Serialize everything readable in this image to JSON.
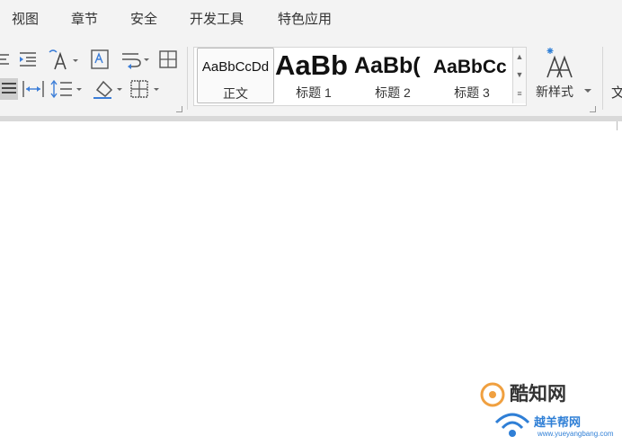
{
  "menu": {
    "items": [
      "视图",
      "章节",
      "安全",
      "开发工具",
      "特色应用"
    ]
  },
  "styles": {
    "gallery": [
      {
        "sample": "AaBbCcDd",
        "label": "正文"
      },
      {
        "sample": "AaBb",
        "label": "标题 1"
      },
      {
        "sample": "AaBb(",
        "label": "标题 2"
      },
      {
        "sample": "AaBbCc",
        "label": "标题 3"
      }
    ],
    "new_style_label": "新样式",
    "next_group_label": "文"
  },
  "watermark": {
    "name": "酷知网",
    "site_name": "越羊帮网",
    "url": "www.yueyangbang.com"
  },
  "colors": {
    "accent_blue": "#2f7fd6",
    "watermark_orange": "#f0a040",
    "ribbon_bg": "#f3f3f3"
  }
}
